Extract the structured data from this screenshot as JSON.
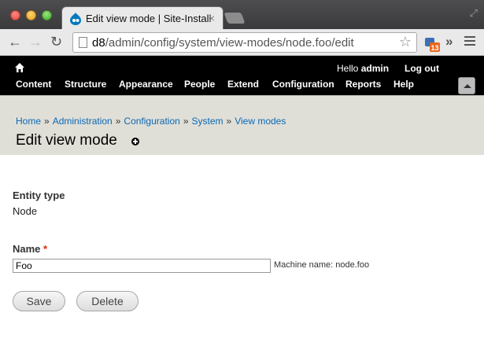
{
  "browser": {
    "tab_title": "Edit view mode | Site-Install",
    "tab_close": "×",
    "url_host": "d8",
    "url_path": "/admin/config/system/view-modes/node.foo/edit",
    "extension_badge": "13",
    "nav": {
      "back": "←",
      "forward": "→",
      "reload": "↻"
    },
    "star": "☆",
    "overflow": "»",
    "resize": "⤢"
  },
  "toolbar": {
    "greeting_prefix": "Hello ",
    "user": "admin",
    "logout": "Log out",
    "menu": [
      "Content",
      "Structure",
      "Appearance",
      "People",
      "Extend",
      "Configuration",
      "Reports",
      "Help"
    ]
  },
  "breadcrumb": [
    "Home",
    "Administration",
    "Configuration",
    "System",
    "View modes"
  ],
  "breadcrumb_separator": "»",
  "page": {
    "title": "Edit view mode"
  },
  "form": {
    "entity_type_label": "Entity type",
    "entity_type_value": "Node",
    "name_label": "Name",
    "required_marker": "*",
    "name_value": "Foo",
    "machine_name_label": "Machine name: ",
    "machine_name_value": "node.foo",
    "save_label": "Save",
    "delete_label": "Delete"
  },
  "colors": {
    "toolbar_bg": "#000000",
    "header_bg": "#e0dfd7",
    "link": "#0a68b5",
    "required": "#e32700"
  }
}
